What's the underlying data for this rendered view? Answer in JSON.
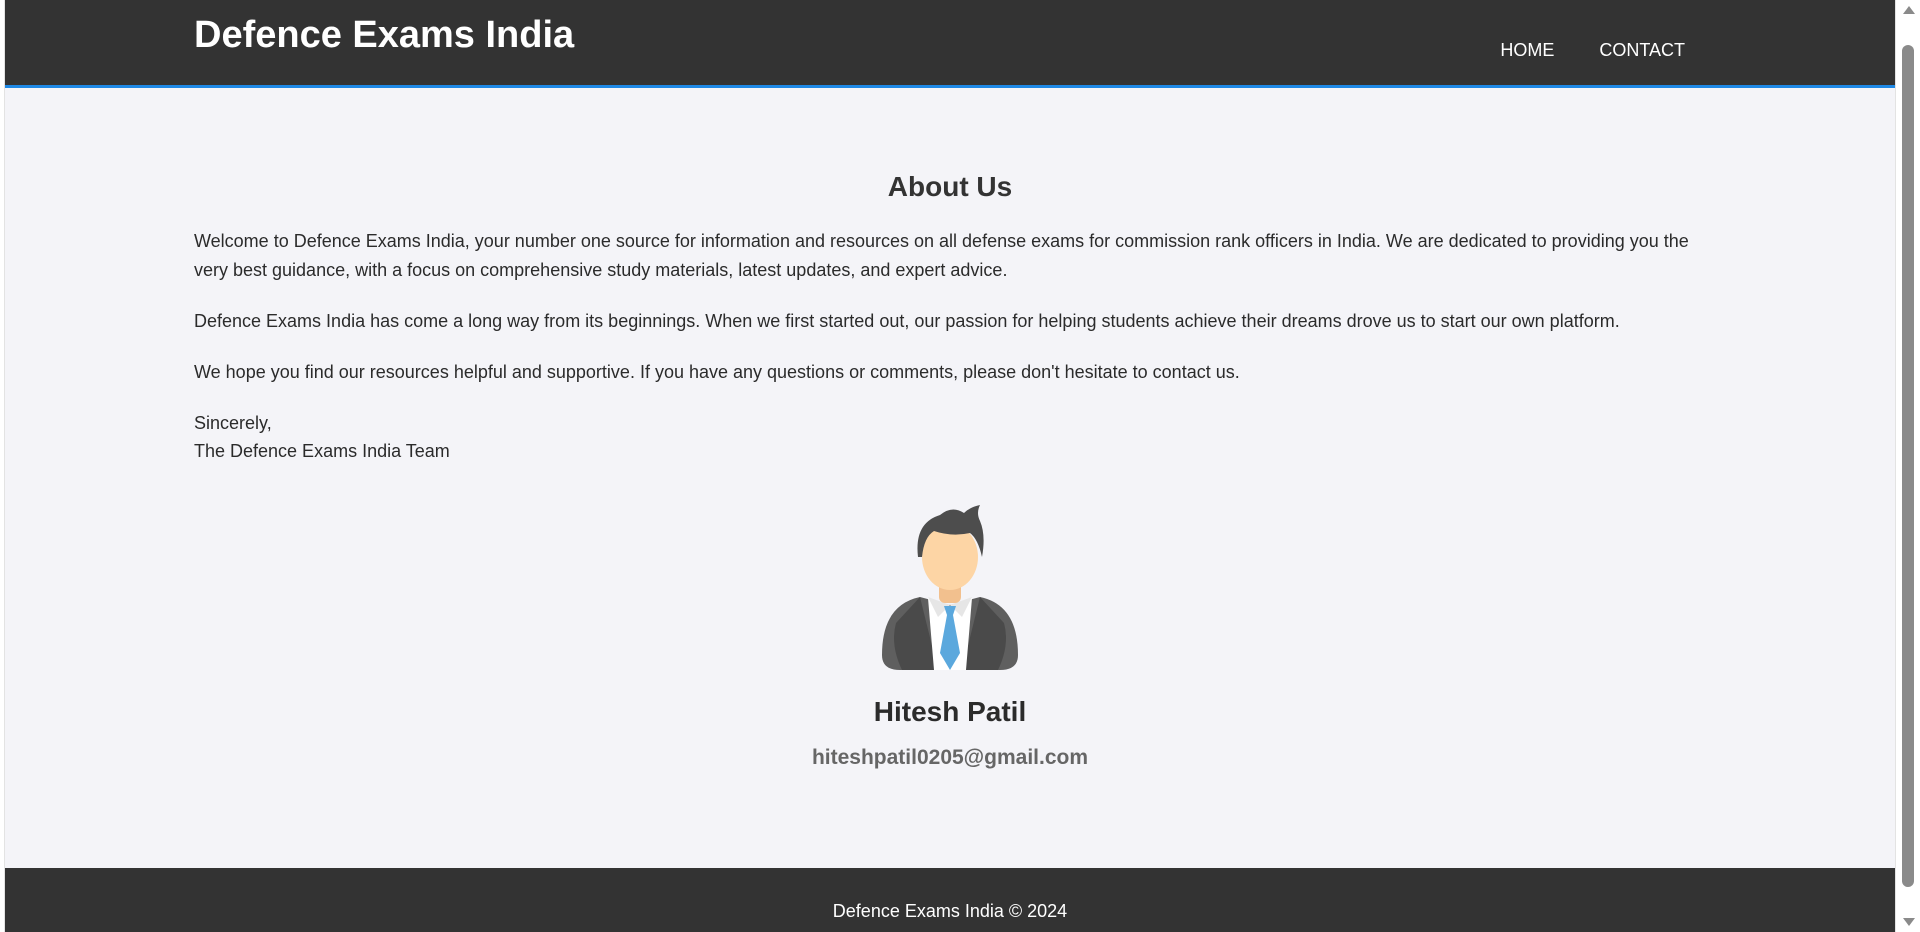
{
  "header": {
    "site_title": "Defence Exams India",
    "nav": [
      {
        "label": "HOME"
      },
      {
        "label": "CONTACT"
      }
    ]
  },
  "about": {
    "heading": "About Us",
    "paragraphs": [
      "Welcome to Defence Exams India, your number one source for information and resources on all defense exams for commission rank officers in India. We are dedicated to providing you the very best guidance, with a focus on comprehensive study materials, latest updates, and expert advice.",
      "Defence Exams India has come a long way from its beginnings. When we first started out, our passion for helping students achieve their dreams drove us to start our own platform.",
      "We hope you find our resources helpful and supportive. If you have any questions or comments, please don't hesitate to contact us."
    ],
    "signoff": "Sincerely,",
    "signature": "The Defence Exams India Team"
  },
  "profile": {
    "avatar_icon": "businessman-avatar-icon",
    "name": "Hitesh Patil",
    "email": "hiteshpatil0205@gmail.com"
  },
  "footer": {
    "text": "Defence Exams India © 2024"
  },
  "colors": {
    "header_bg": "#333333",
    "accent": "#1e88e5",
    "page_bg": "#f4f4f8",
    "tie": "#5ba8dd"
  }
}
